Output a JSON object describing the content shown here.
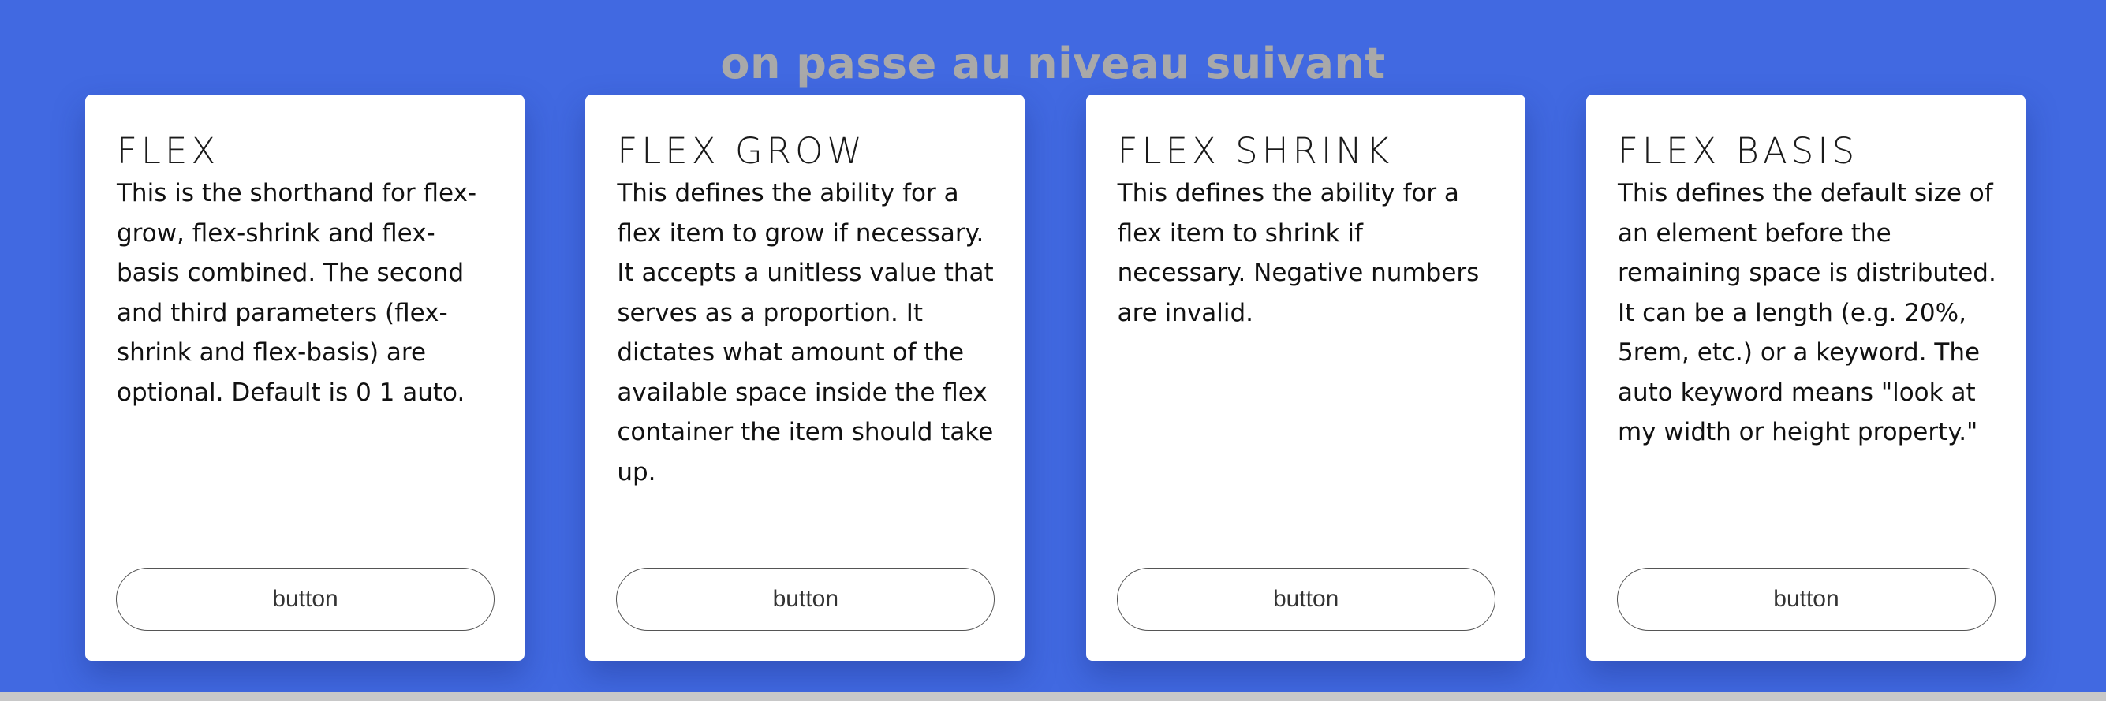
{
  "header": {
    "title": "on passe au niveau suivant"
  },
  "cards": [
    {
      "title": "FLEX",
      "text": "This is the shorthand for flex-grow, flex-shrink and flex-basis combined. The second and third parameters (flex-shrink and flex-basis) are optional. Default is 0 1 auto.",
      "button_label": "button"
    },
    {
      "title": "FLEX GROW",
      "text": "This defines the ability for a flex item to grow if necessary. It accepts a unitless value that serves as a proportion. It dictates what amount of the available space inside the flex container the item should take up.",
      "button_label": "button"
    },
    {
      "title": "FLEX SHRINK",
      "text": "This defines the ability for a flex item to shrink if necessary. Negative numbers are invalid.",
      "button_label": "button"
    },
    {
      "title": "FLEX BASIS",
      "text": "This defines the default size of an element before the remaining space is distributed. It can be a length (e.g. 20%, 5rem, etc.) or a keyword. The auto keyword means \"look at my width or height property.\"",
      "button_label": "button"
    }
  ],
  "colors": {
    "background": "#4169e1",
    "title": "#a9a9a9",
    "card": "#ffffff",
    "button_border": "#555555"
  }
}
